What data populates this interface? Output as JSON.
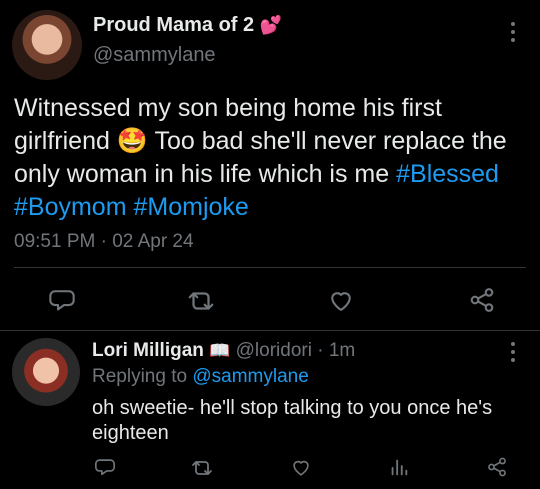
{
  "main_tweet": {
    "author_name": "Proud Mama of 2",
    "author_emoji": "💕",
    "handle": "@sammylane",
    "text_prefix": "Witnessed my son being home his first girlfriend",
    "text_emoji": "🤩",
    "text_suffix": "Too bad she'll never replace the only woman in his life which is me",
    "hashtags": [
      "#Blessed",
      "#Boymom",
      "#Momjoke"
    ],
    "timestamp": "09:51 PM · 02 Apr 24"
  },
  "reply": {
    "author_name": "Lori Milligan",
    "author_emoji": "📖",
    "handle": "@loridori",
    "separator": "·",
    "time": "1m",
    "replying_prefix": "Replying to",
    "replying_to": "@sammylane",
    "text": "oh sweetie- he'll stop talking to you once he's eighteen"
  },
  "colors": {
    "background": "#000000",
    "text": "#e7e9ea",
    "muted": "#71767b",
    "link": "#1d9bf0"
  },
  "icons": {
    "reply": "reply-icon",
    "retweet": "retweet-icon",
    "like": "heart-icon",
    "share": "share-icon",
    "views": "views-icon",
    "more": "more-icon"
  }
}
